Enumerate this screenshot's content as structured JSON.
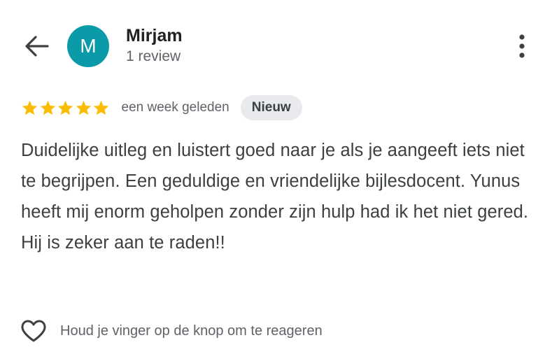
{
  "header": {
    "back_icon": "arrow-left-icon",
    "avatar_initial": "M",
    "avatar_color": "#0b9aa7",
    "reviewer_name": "Mirjam",
    "review_count": "1 review",
    "more_icon": "more-vertical-icon"
  },
  "review": {
    "rating": 5,
    "max_rating": 5,
    "star_color": "#fbbc04",
    "date": "een week geleden",
    "badge": "Nieuw",
    "text": "Duidelijke uitleg en luistert goed naar je als je aangeeft iets niet te begrijpen. Een geduldige en vriendelijke bijlesdocent. Yunus heeft mij enorm geholpen zonder zijn hulp had ik het niet gered. Hij is zeker aan te raden!!"
  },
  "reaction": {
    "icon": "heart-outline-icon",
    "label": "Houd je vinger op de knop om te reageren"
  }
}
